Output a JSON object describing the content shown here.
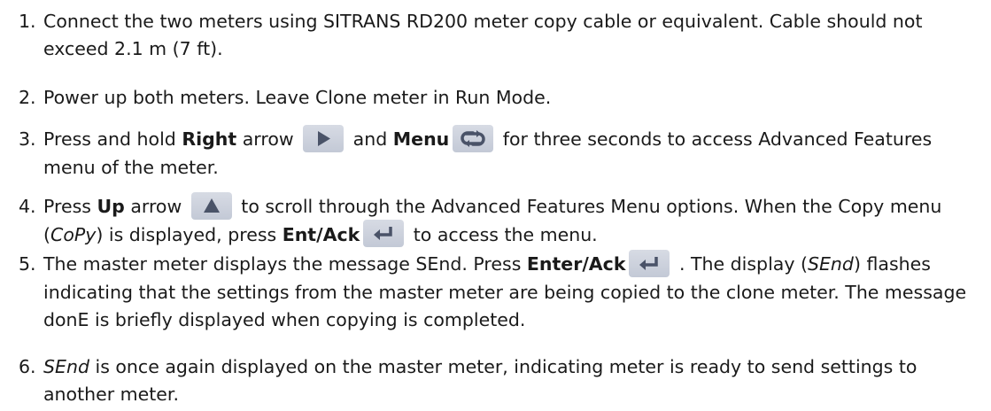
{
  "steps": [
    {
      "num": "1.",
      "t1": "Connect the two meters using SITRANS RD200 meter copy cable or equivalent. Cable should not exceed 2.1 m (7 ft)."
    },
    {
      "num": "2.",
      "t1": "Power up both meters. Leave Clone meter in Run Mode."
    },
    {
      "num": "3.",
      "t1": "Press and hold ",
      "b1": "Right",
      "t2": " arrow ",
      "t3": " and ",
      "b2": "Menu",
      "t4": " for three seconds to access Advanced Features menu of the meter."
    },
    {
      "num": "4.",
      "t1": "Press ",
      "b1": "Up",
      "t2": " arrow ",
      "t3": " to scroll through the Advanced Features Menu options. When the Copy menu (",
      "i1": "CoPy",
      "t4": ") is displayed, press ",
      "b2": "Ent/Ack",
      "t5": " to access the menu."
    },
    {
      "num": "5.",
      "t1": "The master meter displays the message SEnd. Press ",
      "b1": "Enter/Ack",
      "t2": " . The display (",
      "i1": "SEnd",
      "t3": ") flashes indicating that the settings from the master meter are being copied to the clone meter. The message donE is briefly displayed when copying is completed."
    },
    {
      "num": "6.",
      "i1": "SEnd",
      "t1": " is once again displayed on the master meter, indicating meter is ready to send settings to another meter."
    }
  ],
  "icons": {
    "right": "right-arrow-key-icon",
    "menu": "menu-key-icon",
    "up": "up-arrow-key-icon",
    "enter": "enter-ack-key-icon"
  },
  "colors": {
    "key_bg": "#c9ced9",
    "glyph": "#4a5368"
  }
}
